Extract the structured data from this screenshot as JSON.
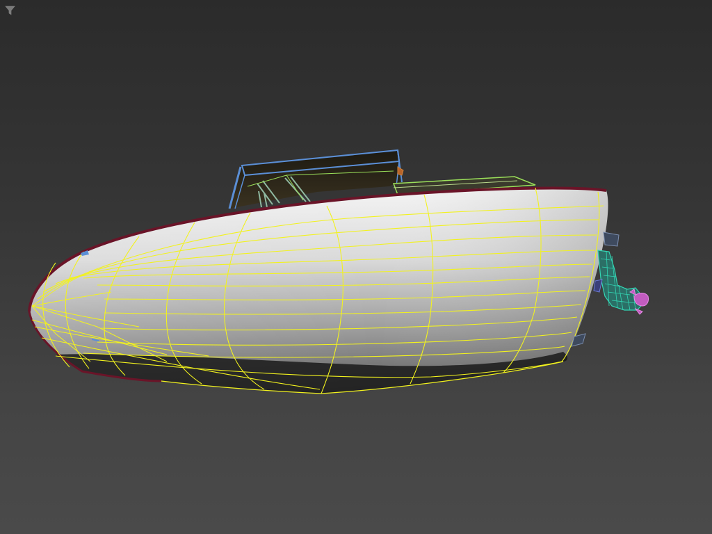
{
  "viewport": {
    "background_top": "#2b2b2b",
    "background_bottom": "#4a4a4a",
    "toolbar": {
      "filter_icon": "filter-funnel-icon"
    },
    "colors": {
      "hull_wire": "#f2f21e",
      "hull_edge": "#6a1428",
      "cabin_wire": "#5b8fd6",
      "frame_wire": "#9be05a",
      "engine_wire": "#33d6b4",
      "propeller_wire": "#e88ae6",
      "bracket_wire": "#7c8fb0"
    }
  }
}
